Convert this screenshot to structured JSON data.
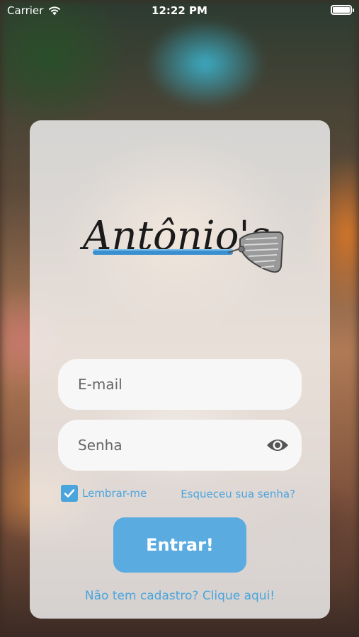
{
  "status_bar": {
    "carrier": "Carrier",
    "time": "12:22 PM"
  },
  "login": {
    "email_placeholder": "E-mail",
    "password_placeholder": "Senha",
    "remember_label": "Lembrar-me",
    "remember_checked": true,
    "forgot_label": "Esqueceu sua senha?",
    "submit_label": "Entrar!",
    "signup_label": "Não tem cadastro? Clique aqui!"
  },
  "logo": {
    "text": "Antonio's"
  },
  "colors": {
    "accent": "#4aa5dd",
    "button": "#5aabe0",
    "card": "#f5f5f5"
  }
}
